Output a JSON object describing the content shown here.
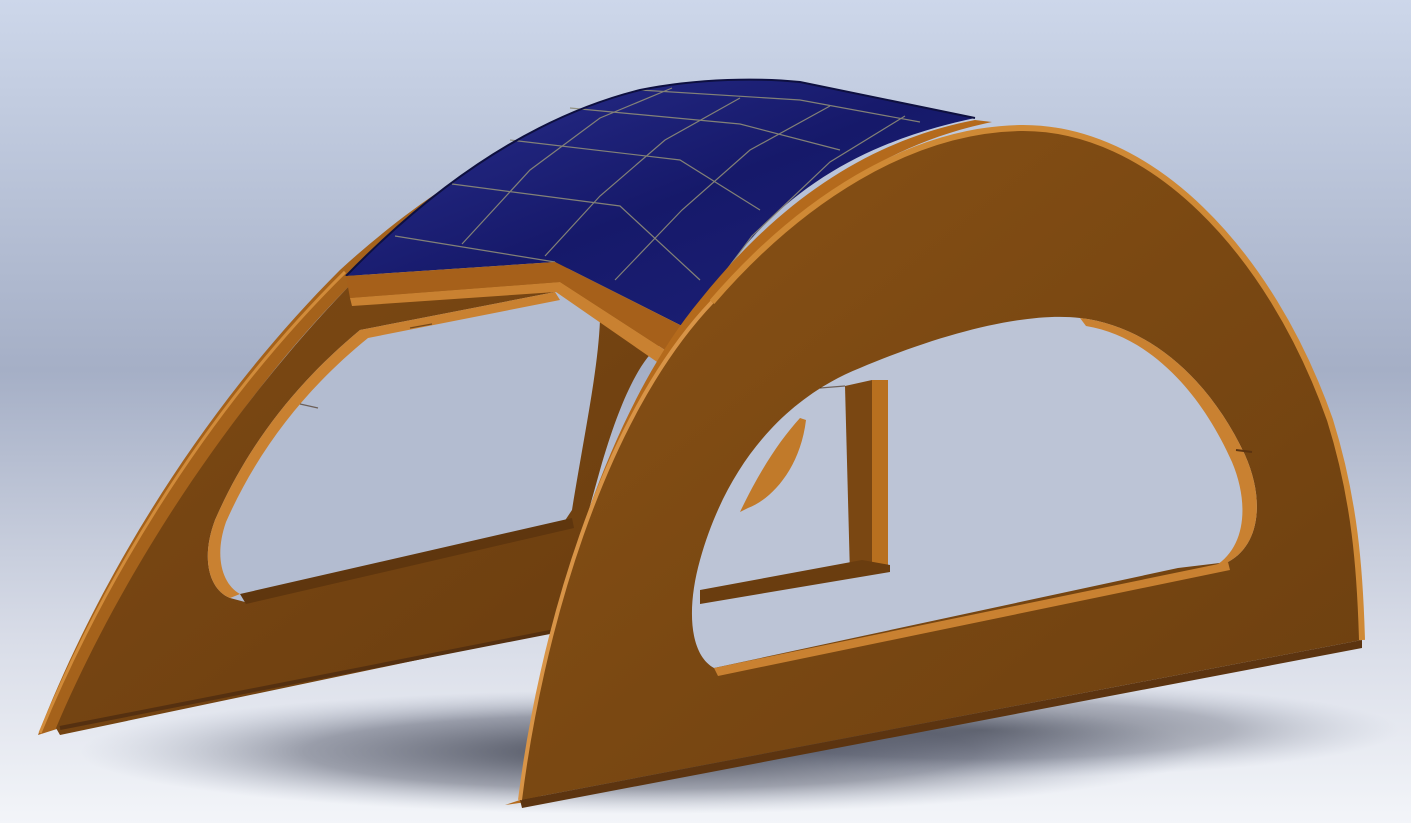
{
  "scene": {
    "subject": "solar-roof-bench-model",
    "colors": {
      "background_top": "#c9d3e6",
      "background_mid": "#a7b2c9",
      "background_bottom": "#f1f3f8",
      "wood_face": "#7d4a13",
      "wood_edge": "#b56c1e",
      "wood_dark": "#5c3410",
      "wood_highlight": "#d08a36",
      "solar_cell": "#171a66",
      "solar_grid": "#8a8a78",
      "shadow": "#2c3040"
    }
  }
}
